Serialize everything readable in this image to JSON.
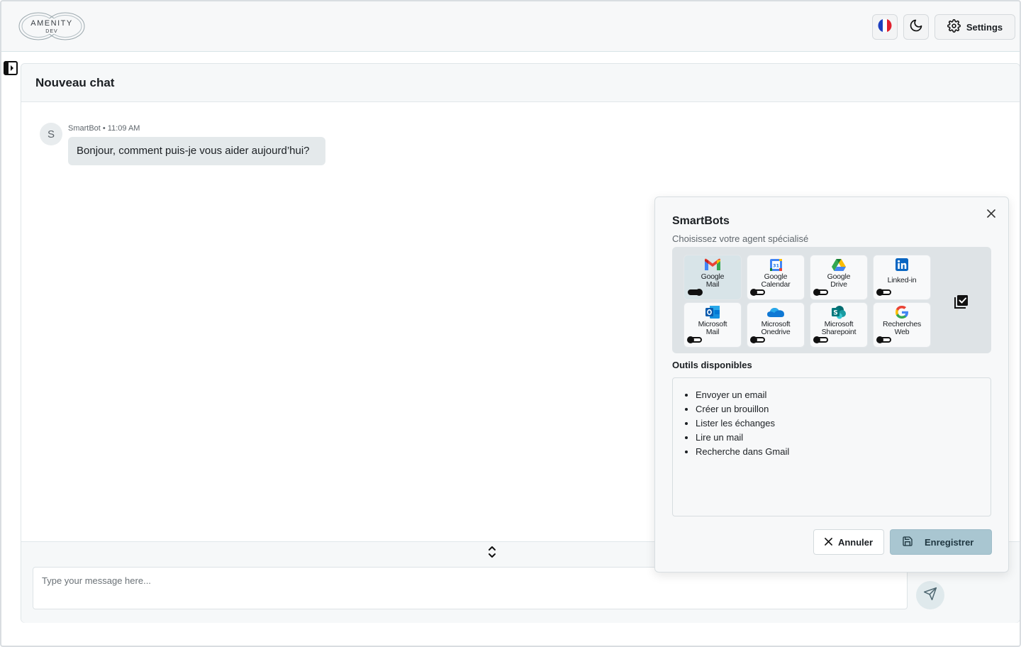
{
  "app": {
    "logo_text": "AMENITY",
    "logo_sub": "DEV"
  },
  "header": {
    "language_icon": "france-flag-icon",
    "theme_icon": "moon-icon",
    "settings_label": "Settings",
    "settings_icon": "gear-icon"
  },
  "chat": {
    "title": "Nouveau chat",
    "messages": [
      {
        "avatar_letter": "S",
        "meta": "SmartBot • 11:09 AM",
        "text": "Bonjour, comment puis-je vous aider aujourd’hui?"
      }
    ],
    "input_placeholder": "Type your message here...",
    "send_icon": "send-icon"
  },
  "smartbots": {
    "title": "SmartBots",
    "subtitle": "Choisissez votre agent spécialisé",
    "agents": [
      {
        "line1": "Google",
        "line2": "Mail",
        "icon": "gmail-icon",
        "enabled": true,
        "selected": true
      },
      {
        "line1": "Google",
        "line2": "Calendar",
        "icon": "google-calendar-icon",
        "enabled": false,
        "selected": false
      },
      {
        "line1": "Google",
        "line2": "Drive",
        "icon": "google-drive-icon",
        "enabled": false,
        "selected": false
      },
      {
        "line1": "Linked-in",
        "line2": "",
        "icon": "linkedin-icon",
        "enabled": false,
        "selected": false
      },
      {
        "line1": "Microsoft",
        "line2": "Mail",
        "icon": "outlook-icon",
        "enabled": false,
        "selected": false
      },
      {
        "line1": "Microsoft",
        "line2": "Onedrive",
        "icon": "onedrive-icon",
        "enabled": false,
        "selected": false
      },
      {
        "line1": "Microsoft",
        "line2": "Sharepoint",
        "icon": "sharepoint-icon",
        "enabled": false,
        "selected": false
      },
      {
        "line1": "Recherches",
        "line2": "Web",
        "icon": "google-icon",
        "enabled": false,
        "selected": false
      }
    ],
    "tools_title": "Outils disponibles",
    "tools": [
      "Envoyer un email",
      "Créer un brouillon",
      "Lister les échanges",
      "Lire un mail",
      "Recherche dans Gmail"
    ],
    "cancel_label": "Annuler",
    "save_label": "Enregistrer"
  },
  "colors": {
    "accent": "#a9c6d1",
    "header_bg": "#f7f8f9",
    "bubble_bg": "#e4e9eb"
  }
}
